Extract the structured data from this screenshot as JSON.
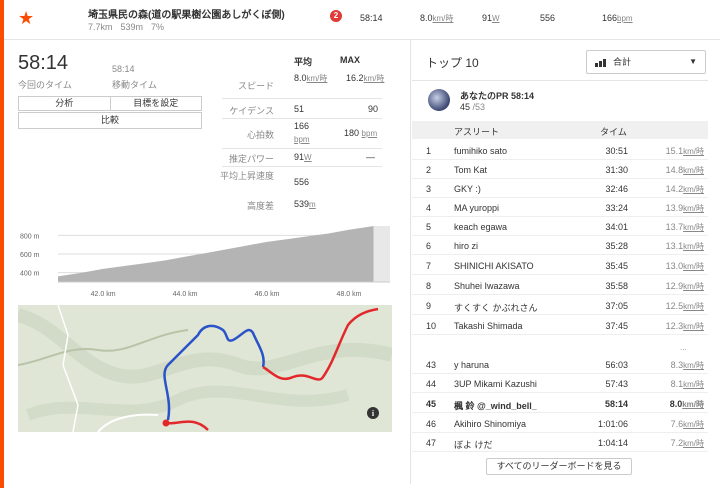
{
  "segment": {
    "name": "埼玉県民の森(道の駅果樹公園あしがくぼ側)",
    "distance": "7.7km",
    "elevation": "539m",
    "grade": "7%",
    "rank": "2",
    "time": "58:14",
    "speed_value": "8.0",
    "speed_unit": "km/時",
    "power_value": "91",
    "power_unit": "W",
    "vam": "556",
    "hr_value": "166",
    "hr_unit": "bpm"
  },
  "summary": {
    "elapsed": "58:14",
    "elapsed_label": "今回のタイム",
    "moving": "58:14",
    "moving_label": "移動タイム",
    "btn_analysis": "分析",
    "btn_goal": "目標を設定",
    "btn_compare": "比較"
  },
  "stats": {
    "head_avg": "平均",
    "head_max": "MAX",
    "speed_label": "スピード",
    "speed_avg": "8.0",
    "speed_avg_unit": "km/時",
    "speed_max": "16.2",
    "speed_max_unit": "km/時",
    "cadence_label": "ケイデンス",
    "cadence_avg": "51",
    "cadence_max": "90",
    "hr_label": "心拍数",
    "hr_avg": "166",
    "hr_unit": "bpm",
    "hr_max": "180",
    "power_label": "推定パワー",
    "power_avg": "91",
    "power_unit": "W",
    "power_max": "—",
    "vam_label": "平均上昇速度",
    "vam_value": "556",
    "elev_label": "高度差",
    "elev_value": "539",
    "elev_unit": "m"
  },
  "chart_data": {
    "type": "area",
    "x": [
      40.9,
      41.5,
      42.0,
      42.5,
      43.0,
      43.5,
      44.0,
      44.5,
      45.0,
      45.5,
      46.0,
      46.5,
      47.0,
      47.5,
      48.0,
      48.6
    ],
    "values": [
      360,
      400,
      440,
      470,
      500,
      530,
      570,
      610,
      650,
      690,
      730,
      760,
      790,
      820,
      860,
      900
    ],
    "xticks": [
      "42.0 km",
      "44.0 km",
      "46.0 km",
      "48.0 km"
    ],
    "yticks": [
      "800 m",
      "600 m",
      "400 m"
    ],
    "xlim": [
      40.9,
      49.0
    ],
    "ylim": [
      300,
      900
    ]
  },
  "leaderboard": {
    "title": "トップ 10",
    "filter": "合計",
    "pr_title": "あなたのPR 58:14",
    "pr_rank": "45",
    "pr_total": "/53",
    "col_athlete": "アスリート",
    "col_time": "タイム",
    "speed_unit": "km/時",
    "rows": [
      {
        "rank": "1",
        "name": "fumihiko sato",
        "time": "30:51",
        "speed": "15.1"
      },
      {
        "rank": "2",
        "name": "Tom Kat",
        "time": "31:30",
        "speed": "14.8"
      },
      {
        "rank": "3",
        "name": "GKY :)",
        "time": "32:46",
        "speed": "14.2"
      },
      {
        "rank": "4",
        "name": "MA yuroppi",
        "time": "33:24",
        "speed": "13.9"
      },
      {
        "rank": "5",
        "name": "keach egawa",
        "time": "34:01",
        "speed": "13.7"
      },
      {
        "rank": "6",
        "name": "hiro zi",
        "time": "35:28",
        "speed": "13.1"
      },
      {
        "rank": "7",
        "name": "SHINICHI AKISATO",
        "time": "35:45",
        "speed": "13.0"
      },
      {
        "rank": "8",
        "name": "Shuhei Iwazawa",
        "time": "35:58",
        "speed": "12.9"
      },
      {
        "rank": "9",
        "name": "すくすく かぶれさん",
        "time": "37:05",
        "speed": "12.5"
      },
      {
        "rank": "10",
        "name": "Takashi Shimada",
        "time": "37:45",
        "speed": "12.3"
      },
      {
        "rank": "43",
        "name": "y haruna",
        "time": "56:03",
        "speed": "8.3"
      },
      {
        "rank": "44",
        "name": "3UP Mikami Kazushi",
        "time": "57:43",
        "speed": "8.1"
      },
      {
        "rank": "45",
        "name": "楓 鈴 @_wind_bell_",
        "time": "58:14",
        "speed": "8.0",
        "me": true
      },
      {
        "rank": "46",
        "name": "Akihiro Shinomiya",
        "time": "1:01:06",
        "speed": "7.6"
      },
      {
        "rank": "47",
        "name": "ぼよ けだ",
        "time": "1:04:14",
        "speed": "7.2"
      }
    ],
    "ellipsis": "...",
    "all_button": "すべてのリーダーボードを見る"
  },
  "map": {
    "info_icon": "i"
  }
}
